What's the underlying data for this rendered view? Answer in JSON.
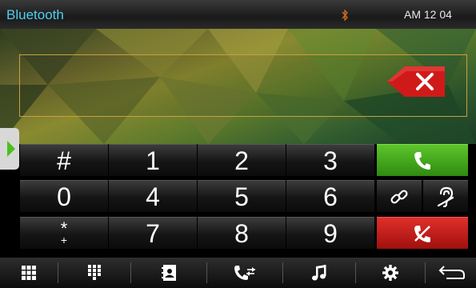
{
  "header": {
    "title": "Bluetooth",
    "clock": "AM 12 04"
  },
  "keypad": {
    "rows": [
      [
        "#",
        "1",
        "2",
        "3"
      ],
      [
        "0",
        "4",
        "5",
        "6"
      ],
      [
        "*\n+",
        "7",
        "8",
        "9"
      ]
    ],
    "star_top": "*",
    "star_bottom": "+"
  },
  "colors": {
    "accent_text": "#4fd0f0",
    "call": "#3fa81a",
    "hangup": "#c81c18",
    "delete": "#d01a1a",
    "frame": "#c8a040"
  },
  "icons": {
    "header": [
      "bluetooth-icon"
    ],
    "right_keys": [
      "phone-call-icon",
      "link-icon",
      "ear-icon",
      "hangup-icon"
    ],
    "delete": "backspace-x-icon",
    "toolbar": [
      "keypad-grid-icon",
      "dialpad-icon",
      "contacts-icon",
      "call-log-icon",
      "music-note-icon",
      "settings-gear-icon",
      "back-arrow-icon"
    ]
  }
}
